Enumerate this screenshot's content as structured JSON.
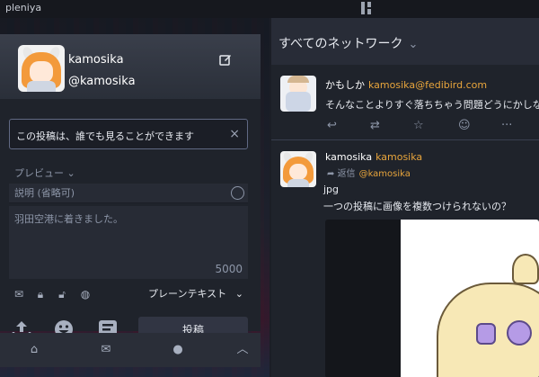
{
  "app": {
    "title": "pleniya"
  },
  "compose": {
    "profile_name": "kamosika",
    "profile_handle": "@kamosika",
    "visibility_text": "この投稿は、誰でも見ることができます",
    "preview_label": "プレビュー",
    "cw_placeholder": "説明 (省略可)",
    "text_placeholder": "羽田空港に着きました。",
    "char_count": "5000",
    "format_label": "プレーンテキスト",
    "post_label": "投稿"
  },
  "column": {
    "title": "すべてのネットワーク",
    "statuses": [
      {
        "display_name": "かもしか",
        "acct": "kamosika@fedibird.com",
        "text": "そんなことよりすぐ落ちちゃう問題どうにかしなさ"
      },
      {
        "display_name": "kamosika",
        "acct": "kamosika",
        "reply_label": "返信",
        "reply_to": "@kamosika",
        "text_line1": "jpg",
        "text_line2": "一つの投稿に画像を複数つけられないの？"
      }
    ]
  },
  "colors": {
    "accent_orange": "#e8a53c",
    "background": "#1b1e26",
    "panel": "#1f232b",
    "header": "#282c37"
  }
}
